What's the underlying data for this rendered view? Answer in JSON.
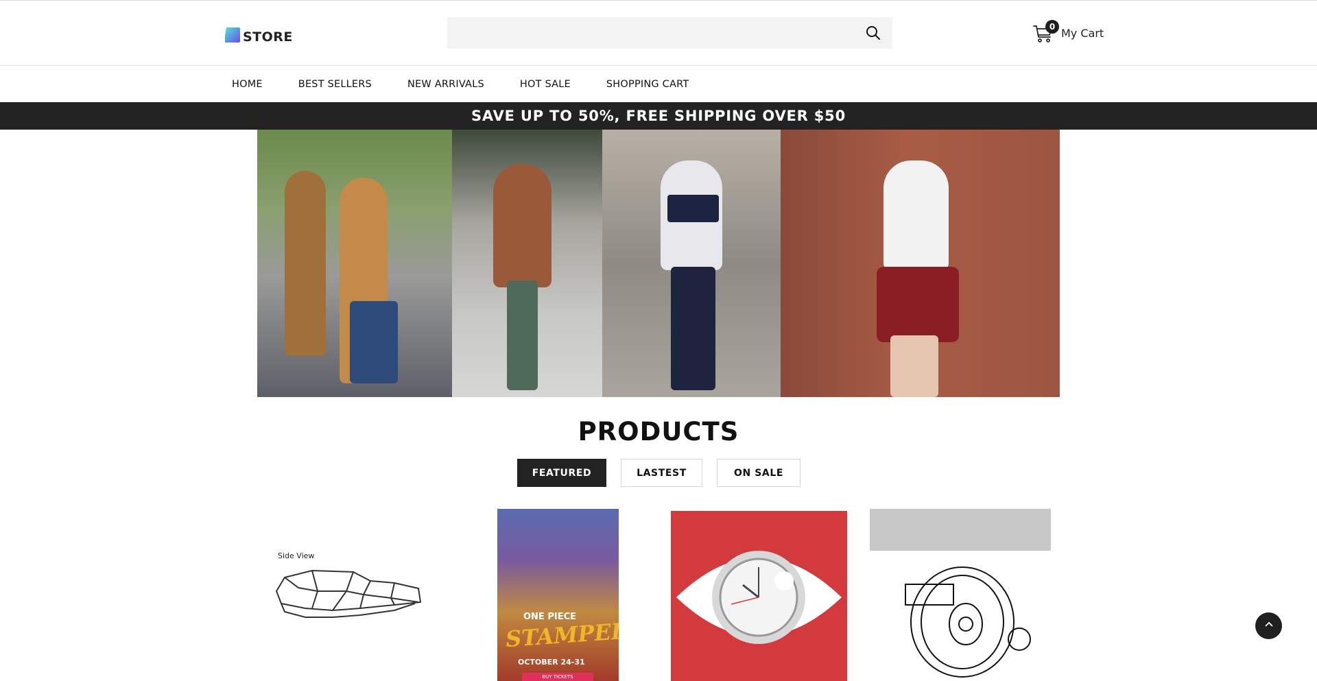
{
  "header": {
    "logo_text": "STORE",
    "search": {
      "value": "",
      "placeholder": ""
    },
    "cart": {
      "count": "0",
      "label": "My Cart"
    }
  },
  "nav": {
    "items": [
      {
        "label": "HOME"
      },
      {
        "label": "BEST SELLERS"
      },
      {
        "label": "NEW ARRIVALS"
      },
      {
        "label": "HOT SALE"
      },
      {
        "label": "SHOPPING CART"
      }
    ]
  },
  "promo": {
    "text": "SAVE UP TO 50%, FREE SHIPPING OVER $50"
  },
  "products": {
    "title": "PRODUCTS",
    "tabs": [
      {
        "label": "FEATURED",
        "active": true
      },
      {
        "label": "LASTEST",
        "active": false
      },
      {
        "label": "ON SALE",
        "active": false
      }
    ],
    "cards": [
      {
        "image_caption": "Side View"
      },
      {
        "poster_title": "ONE PIECE",
        "poster_subtitle": "STAMPEDE",
        "poster_date": "OCTOBER 24-31",
        "poster_button": "BUY TICKETS"
      },
      {},
      {}
    ]
  },
  "colors": {
    "promo_bar": "#222222",
    "active_tab": "#222222",
    "logo_gradient_start": "#4ee6d0",
    "logo_gradient_end": "#6b4cf0"
  },
  "icons": [
    "logo-icon",
    "search-icon",
    "cart-icon",
    "chevron-up-icon"
  ]
}
